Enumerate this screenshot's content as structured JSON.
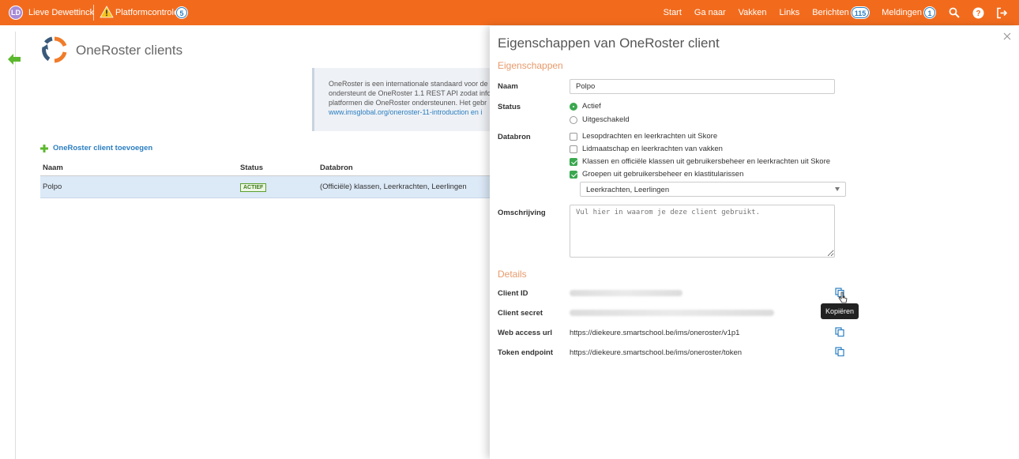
{
  "topbar": {
    "avatar_initials": "LD",
    "user_name": "Lieve Dewettinck",
    "platform_label": "Platformcontrole",
    "platform_count": "5",
    "nav": {
      "start": "Start",
      "ganaar": "Ga naar",
      "vakken": "Vakken",
      "links": "Links",
      "berichten": "Berichten",
      "berichten_count": "115",
      "meldingen": "Meldingen",
      "meldingen_count": "1"
    },
    "icons": [
      "search-icon",
      "help-icon",
      "logout-icon"
    ]
  },
  "page": {
    "title": "OneRoster clients",
    "info_lines": [
      "OneRoster is een internationale standaard voor de",
      "ondersteunt de OneRoster 1.1 REST API zodat info",
      "platformen die OneRoster ondersteunen. Het gebr",
      "www.imsglobal.org/oneroster-11-introduction en i"
    ],
    "add_label": "OneRoster client toevoegen"
  },
  "table": {
    "headers": [
      "Naam",
      "Status",
      "Databron"
    ],
    "rows": [
      {
        "naam": "Polpo",
        "status": "ACTIEF",
        "databron": "(Officiële) klassen, Leerkrachten, Leerlingen"
      }
    ]
  },
  "panel": {
    "title": "Eigenschappen van OneRoster client",
    "section_props": "Eigenschappen",
    "naam_label": "Naam",
    "naam_value": "Polpo",
    "status_label": "Status",
    "status_options": [
      "Actief",
      "Uitgeschakeld"
    ],
    "status_selected": "Actief",
    "databron_label": "Databron",
    "databron_options": [
      {
        "label": "Lesopdrachten en leerkrachten uit Skore",
        "checked": false
      },
      {
        "label": "Lidmaatschap en leerkrachten van vakken",
        "checked": false
      },
      {
        "label": "Klassen en officiële klassen uit gebruikersbeheer en leerkrachten uit Skore",
        "checked": true
      },
      {
        "label": "Groepen uit gebruikersbeheer en klastitularissen",
        "checked": true
      }
    ],
    "groepen_select": "Leerkrachten, Leerlingen",
    "omschrijving_label": "Omschrijving",
    "omschrijving_placeholder": "Vul hier in waarom je deze client gebruikt.",
    "section_details": "Details",
    "client_id_label": "Client ID",
    "client_secret_label": "Client secret",
    "web_url_label": "Web access url",
    "web_url_value": "https://diekeure.smartschool.be/ims/oneroster/v1p1",
    "token_label": "Token endpoint",
    "token_value": "https://diekeure.smartschool.be/ims/oneroster/token",
    "tooltip": "Kopiëren"
  },
  "colors": {
    "topbar": "#f26b1d",
    "accent_blue": "#2a7ec1",
    "active_green": "#3aa84f",
    "section_orange": "#e89a6b"
  }
}
